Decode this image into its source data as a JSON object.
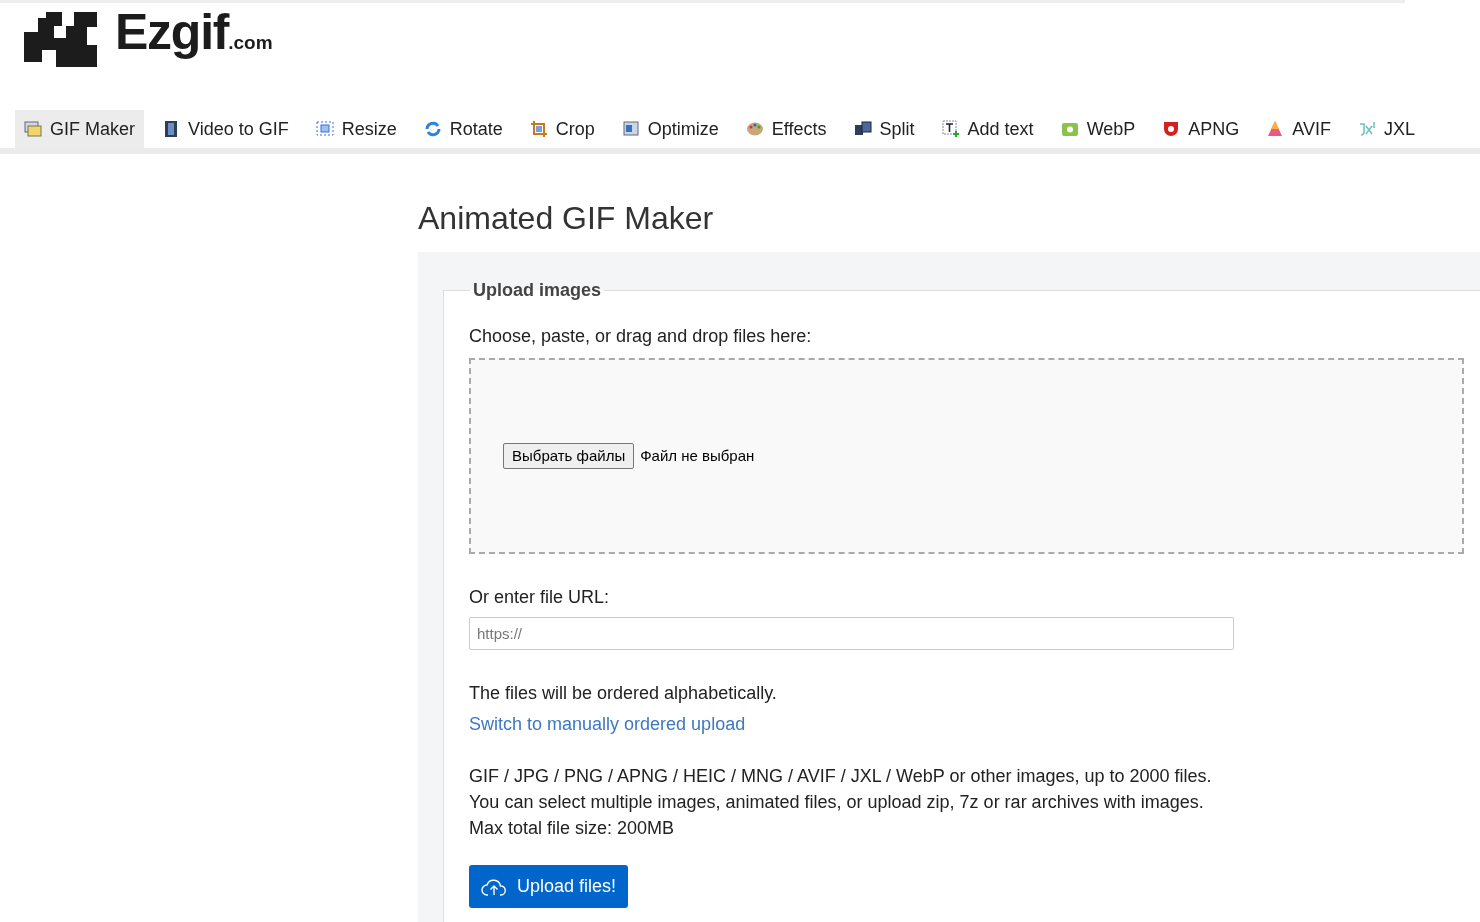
{
  "logo": {
    "name": "Ezgif",
    "suffix": ".com"
  },
  "tabs": [
    {
      "label": "GIF Maker",
      "selected": true
    },
    {
      "label": "Video to GIF",
      "selected": false
    },
    {
      "label": "Resize",
      "selected": false
    },
    {
      "label": "Rotate",
      "selected": false
    },
    {
      "label": "Crop",
      "selected": false
    },
    {
      "label": "Optimize",
      "selected": false
    },
    {
      "label": "Effects",
      "selected": false
    },
    {
      "label": "Split",
      "selected": false
    },
    {
      "label": "Add text",
      "selected": false
    },
    {
      "label": "WebP",
      "selected": false
    },
    {
      "label": "APNG",
      "selected": false
    },
    {
      "label": "AVIF",
      "selected": false
    },
    {
      "label": "JXL",
      "selected": false
    }
  ],
  "page_title": "Animated GIF Maker",
  "upload": {
    "legend": "Upload images",
    "drop_prompt": "Choose, paste, or drag and drop files here:",
    "file_button": "Выбрать файлы",
    "file_status": "Файл не выбран",
    "url_label": "Or enter file URL:",
    "url_placeholder": "https://",
    "order_note": "The files will be ordered alphabetically.",
    "order_link": "Switch to manually ordered upload",
    "info_lines": [
      "GIF / JPG / PNG / APNG / HEIC / MNG / AVIF / JXL / WebP or other images, up to 2000 files.",
      "You can select multiple images, animated files, or upload zip, 7z or rar archives with images.",
      "Max total file size: 200MB"
    ],
    "submit": "Upload files!"
  }
}
